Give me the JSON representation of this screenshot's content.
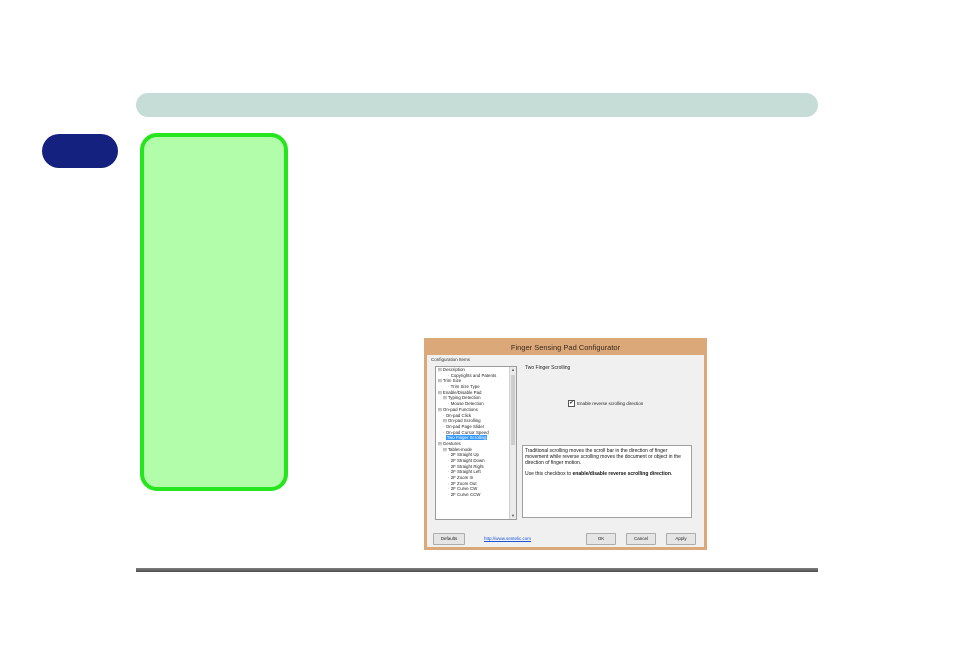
{
  "dialog": {
    "title": "Finger Sensing Pad Configurator",
    "section_label": "Configuration Items",
    "tree_items": [
      {
        "label": "Description",
        "indent": 0,
        "prefix": "⊟ "
      },
      {
        "label": "Copyrights and Patents",
        "indent": 2,
        "prefix": "· "
      },
      {
        "label": "Trim Size",
        "indent": 0,
        "prefix": "⊟ "
      },
      {
        "label": "Trim Size Type",
        "indent": 2,
        "prefix": "· "
      },
      {
        "label": "Enable/Disable Pad",
        "indent": 0,
        "prefix": "⊟ "
      },
      {
        "label": "Typing Detection",
        "indent": 1,
        "prefix": "⊟ "
      },
      {
        "label": "Mouse Detection",
        "indent": 2,
        "prefix": "· "
      },
      {
        "label": "On-pad Functions",
        "indent": 0,
        "prefix": "⊟ "
      },
      {
        "label": "On-pad Click",
        "indent": 1,
        "prefix": "· "
      },
      {
        "label": "On-pad Scrolling",
        "indent": 1,
        "prefix": "⊟ "
      },
      {
        "label": "On-pad Page Slider",
        "indent": 1,
        "prefix": "· "
      },
      {
        "label": "On-pad Cursor Speed",
        "indent": 1,
        "prefix": "· "
      },
      {
        "label": "Two Finger Scrolling",
        "indent": 1,
        "prefix": "· ",
        "selected": true
      },
      {
        "label": "Gestures",
        "indent": 0,
        "prefix": "⊟ "
      },
      {
        "label": "Tablet-mode",
        "indent": 1,
        "prefix": "⊟ "
      },
      {
        "label": "2F Straight Up",
        "indent": 2,
        "prefix": "· "
      },
      {
        "label": "2F Straight Down",
        "indent": 2,
        "prefix": "· "
      },
      {
        "label": "2F Straight Right",
        "indent": 2,
        "prefix": "· "
      },
      {
        "label": "2F Straight Left",
        "indent": 2,
        "prefix": "· "
      },
      {
        "label": "2F Zoom In",
        "indent": 2,
        "prefix": "· "
      },
      {
        "label": "2F Zoom Out",
        "indent": 2,
        "prefix": "· "
      },
      {
        "label": "2F Curve CW",
        "indent": 2,
        "prefix": "· "
      },
      {
        "label": "2F Curve CCW",
        "indent": 2,
        "prefix": "· "
      }
    ],
    "panel_title": "Two Finger Scrolling",
    "checkbox_label": "Enable reverse scrolling direction",
    "checkbox_checked": true,
    "description_p1": "Traditional scrolling moves the scroll bar in the direction of finger movement while reverse scrolling moves the document or object in the direction of finger motion.",
    "description_p2_prefix": "Use this checkbox to ",
    "description_p2_bold": "enable/disable reverse scrolling direction",
    "description_p2_suffix": ".",
    "buttons": {
      "defaults": "Defaults",
      "ok": "OK",
      "cancel": "Cancel",
      "apply": "Apply"
    },
    "link": "http://www.sentelic.com"
  },
  "colors": {
    "header_bar": "#c5dcd7",
    "side_tab": "#14217f",
    "green_box_fill": "#b2fda9",
    "green_box_border": "#25e51e",
    "dialog_frame": "#dba87a"
  }
}
